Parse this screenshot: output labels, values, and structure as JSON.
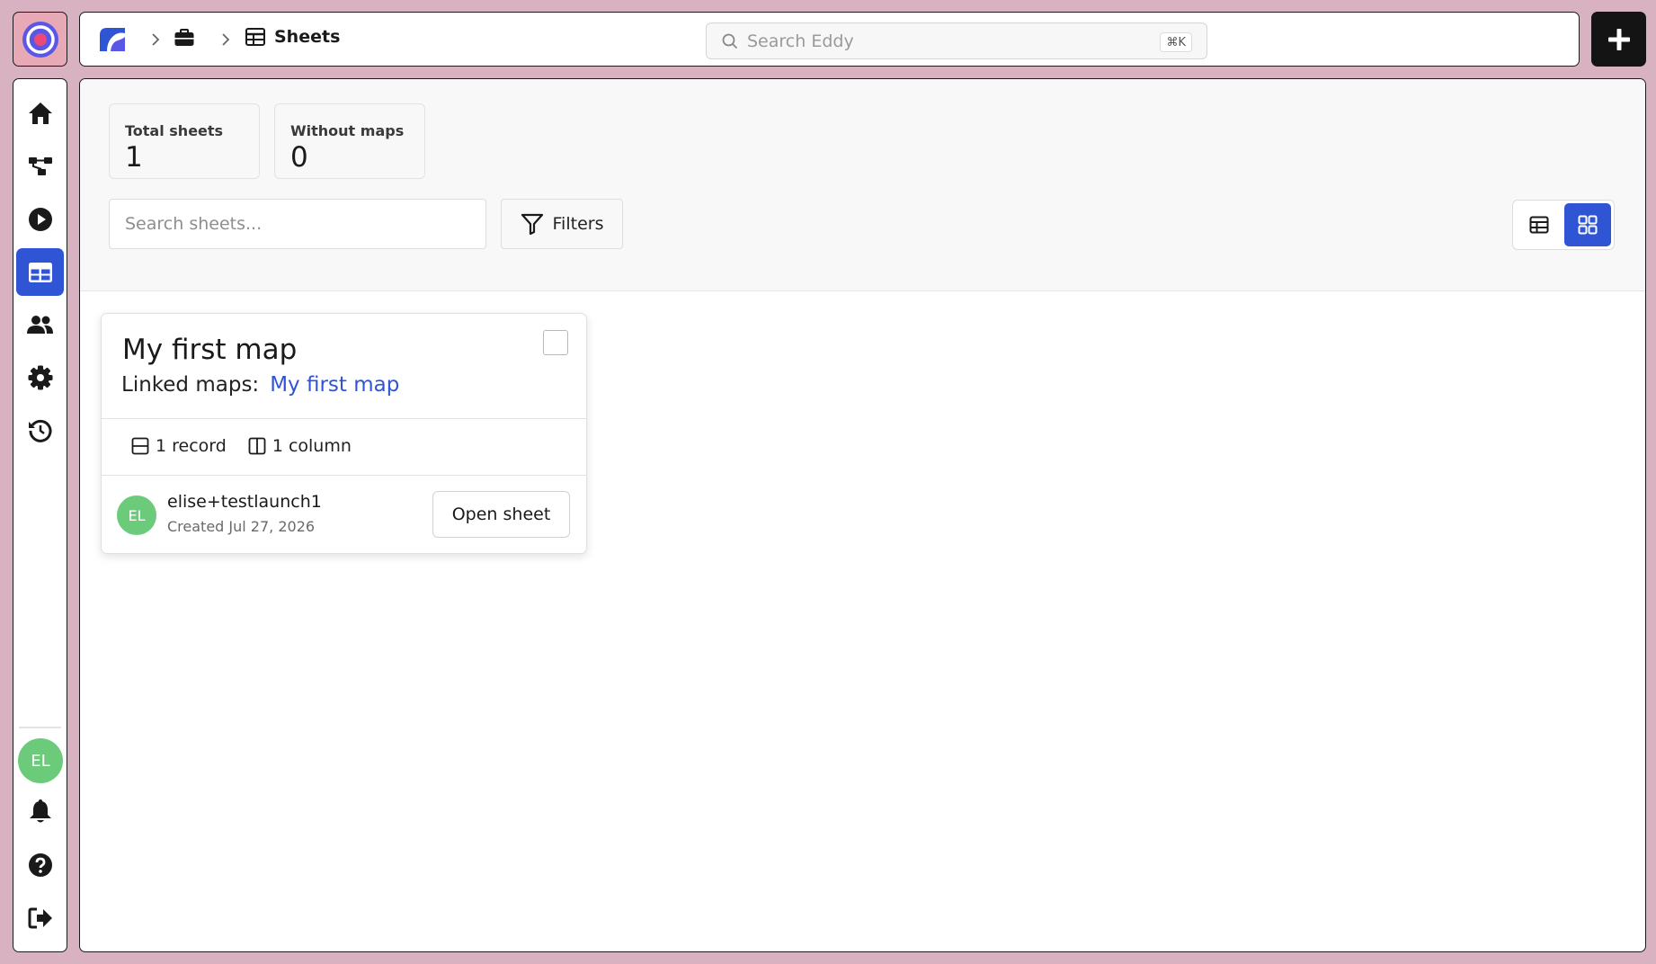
{
  "header": {
    "breadcrumb": {
      "current_label": "Sheets"
    },
    "search": {
      "placeholder": "Search Eddy",
      "shortcut": "⌘K"
    }
  },
  "sidebar": {
    "items": [
      {
        "name": "home",
        "icon": "home-icon"
      },
      {
        "name": "workflows",
        "icon": "workflow-icon"
      },
      {
        "name": "runs",
        "icon": "play-icon"
      },
      {
        "name": "sheets",
        "icon": "table-icon",
        "active": true
      },
      {
        "name": "team",
        "icon": "users-icon"
      },
      {
        "name": "settings",
        "icon": "gear-icon"
      },
      {
        "name": "history",
        "icon": "history-icon"
      }
    ],
    "user_initials": "EL"
  },
  "stats": {
    "total_label": "Total sheets",
    "total_value": "1",
    "without_label": "Without maps",
    "without_value": "0"
  },
  "toolbar": {
    "search_placeholder": "Search sheets...",
    "filters_label": "Filters",
    "active_view": "grid"
  },
  "card": {
    "title": "My first map",
    "linked_label": "Linked maps:",
    "linked_map": "My first map",
    "records": "1 record",
    "columns": "1 column",
    "owner_initials": "EL",
    "owner": "elise+testlaunch1",
    "created": "Created Jul 27, 2026",
    "open_label": "Open sheet"
  },
  "colors": {
    "accent": "#2f55d4",
    "avatar": "#6ccb7b",
    "frame": "#d8b2c1"
  }
}
